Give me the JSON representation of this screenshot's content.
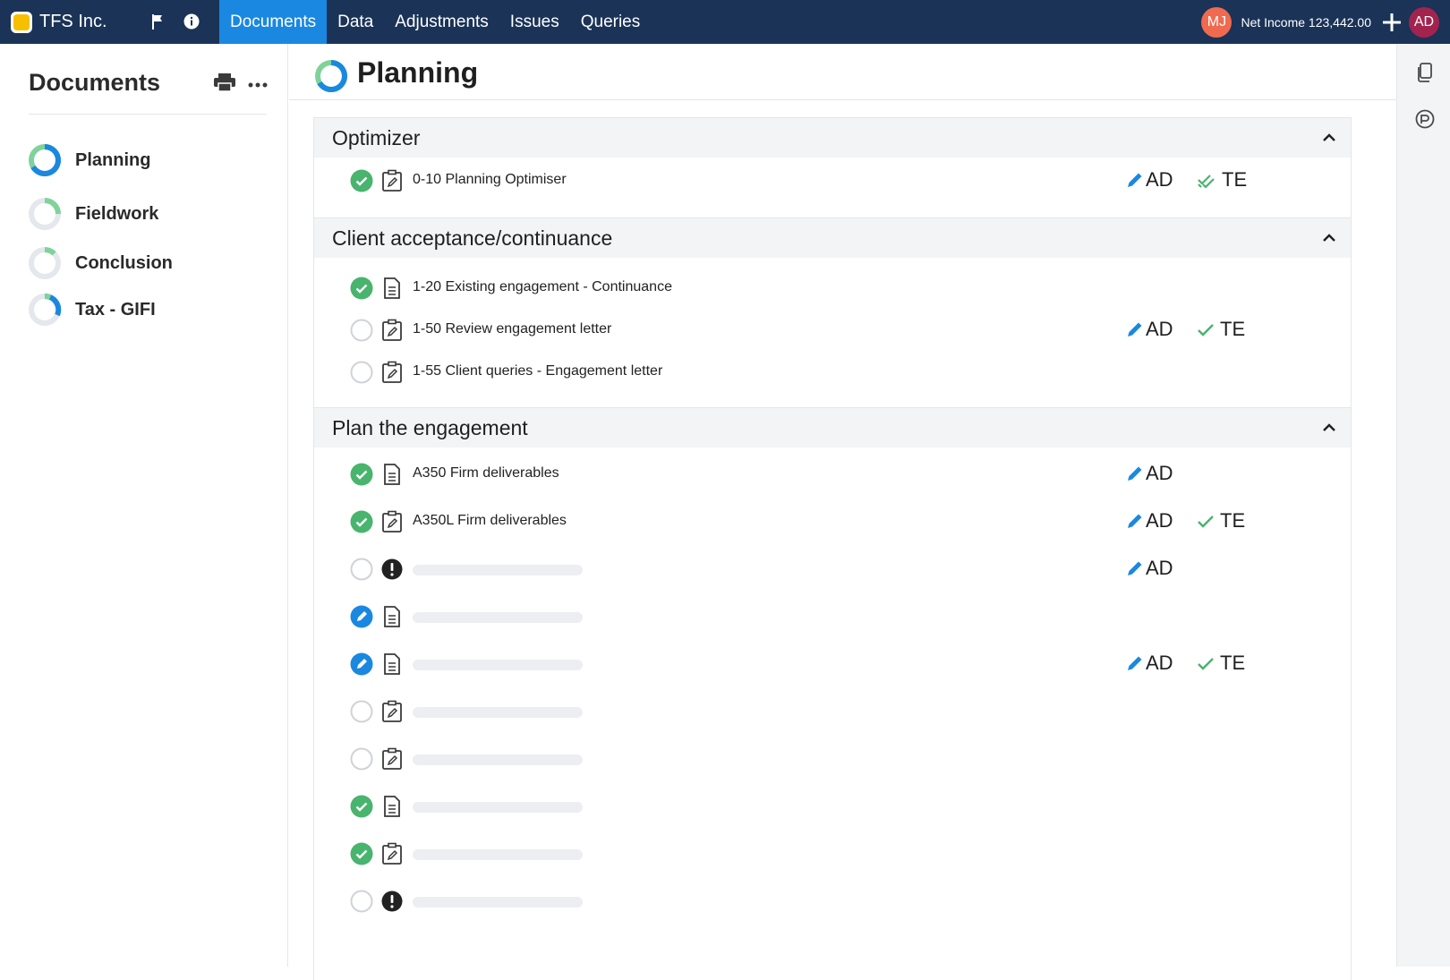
{
  "topbar": {
    "company": "TFS Inc.",
    "nav": [
      "Documents",
      "Data",
      "Adjustments",
      "Issues",
      "Queries"
    ],
    "active_tab": "Documents",
    "user_initials_1": "MJ",
    "net_income": "Net Income 123,442.00",
    "user_initials_2": "AD",
    "colors": {
      "bar": "#1a3357",
      "active": "#1a88e0",
      "mj": "#f06a4f",
      "ad": "#a3234f"
    }
  },
  "sidebar": {
    "title": "Documents",
    "items": [
      {
        "label": "Planning"
      },
      {
        "label": "Fieldwork"
      },
      {
        "label": "Conclusion"
      },
      {
        "label": "Tax - GIFI"
      }
    ]
  },
  "main": {
    "title": "Planning",
    "sections": [
      {
        "title": "Optimizer",
        "rows": [
          {
            "status": "complete",
            "type": "form",
            "name": "0-10 Planning Optimiser",
            "ad": "AD",
            "te": "TE"
          }
        ]
      },
      {
        "title": "Client acceptance/continuance",
        "rows": [
          {
            "status": "complete",
            "type": "document",
            "name": "1-20 Existing engagement - Continuance"
          },
          {
            "status": "empty",
            "type": "form",
            "name": "1-50 Review engagement letter",
            "ad": "AD",
            "te": "TE"
          },
          {
            "status": "empty",
            "type": "form",
            "name": "1-55 Client queries - Engagement letter"
          }
        ]
      },
      {
        "title": "Plan the engagement",
        "rows": [
          {
            "status": "complete",
            "type": "document",
            "name": "A350 Firm deliverables",
            "ad": "AD"
          },
          {
            "status": "complete",
            "type": "form",
            "name": "A350L Firm deliverables",
            "ad": "AD",
            "te": "TE"
          },
          {
            "status": "empty",
            "type": "alert",
            "ad": "AD"
          },
          {
            "status": "editing",
            "type": "document"
          },
          {
            "status": "editing",
            "type": "document",
            "ad": "AD",
            "te": "TE"
          },
          {
            "status": "empty",
            "type": "form"
          },
          {
            "status": "empty",
            "type": "form"
          },
          {
            "status": "complete",
            "type": "document"
          },
          {
            "status": "complete",
            "type": "form"
          },
          {
            "status": "empty",
            "type": "alert"
          }
        ]
      }
    ]
  }
}
